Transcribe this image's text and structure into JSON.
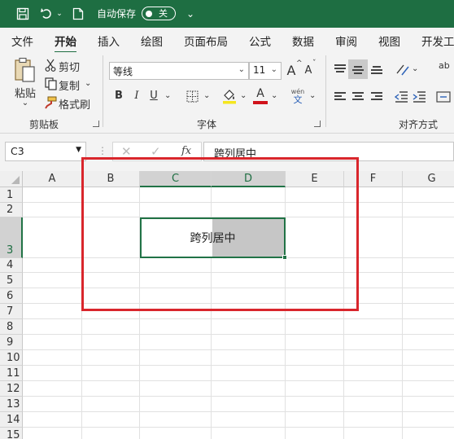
{
  "titlebar": {
    "autosave_label": "自动保存",
    "autosave_state": "关"
  },
  "menu": {
    "tabs": [
      "文件",
      "开始",
      "插入",
      "绘图",
      "页面布局",
      "公式",
      "数据",
      "审阅",
      "视图",
      "开发工"
    ]
  },
  "ribbon": {
    "clipboard": {
      "paste": "粘贴",
      "cut": "剪切",
      "copy": "复制",
      "format_painter": "格式刷",
      "group_label": "剪贴板"
    },
    "font": {
      "font_name": "等线",
      "font_size": "11",
      "bold": "B",
      "italic": "I",
      "underline": "U",
      "grow": "A",
      "shrink": "A",
      "font_color": "A",
      "phonetic_top": "wén",
      "phonetic_bottom": "文",
      "group_label": "字体"
    },
    "alignment": {
      "group_label": "对齐方式",
      "wrap_label": "ab"
    }
  },
  "formula_bar": {
    "name_box": "C3",
    "fx": "fx",
    "formula": "跨列居中"
  },
  "sheet": {
    "columns": [
      "A",
      "B",
      "C",
      "D",
      "E",
      "F",
      "G"
    ],
    "rows": [
      "1",
      "2",
      "3",
      "4",
      "5",
      "6",
      "7",
      "8",
      "9",
      "10",
      "11",
      "12",
      "13",
      "14",
      "15"
    ],
    "selected_cell_text": "跨列居中"
  },
  "colors": {
    "accent": "#1e6e42",
    "highlight_box": "#d9262c"
  }
}
